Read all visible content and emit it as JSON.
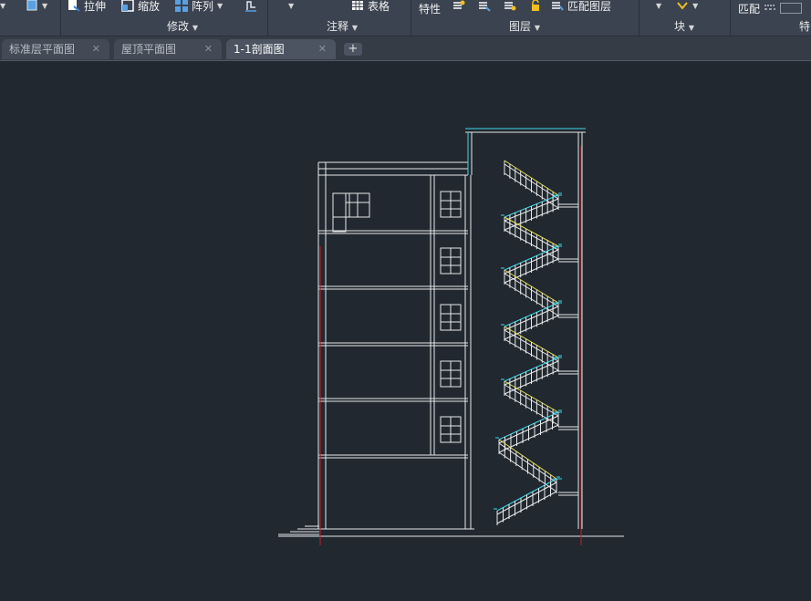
{
  "ribbon": {
    "stretch_label": "拉伸",
    "scale_label": "缩放",
    "array_label": "阵列",
    "table_label": "表格",
    "properties_label": "特性",
    "match_layer_label": "匹配图层",
    "match_label": "匹配",
    "panels": {
      "modify": "修改",
      "annotation": "注释",
      "layers": "图层",
      "block": "块",
      "properties_cut": "特"
    }
  },
  "tabs": [
    {
      "label": "标准层平面图",
      "active": false
    },
    {
      "label": "屋顶平面图",
      "active": false
    },
    {
      "label": "1-1剖面图",
      "active": true
    }
  ],
  "tab_close_glyph": "✕",
  "tab_add_glyph": "+",
  "colors": {
    "canvas": "#212830",
    "line_white": "#e8e8e8",
    "line_cyan": "#3fd8e8",
    "line_yellow": "#e8e04a",
    "line_red": "#c0202a"
  },
  "icons": [
    "dropdown-caret-icon",
    "stretch-icon",
    "scale-icon",
    "array-icon",
    "table-icon",
    "layer-icons",
    "match-icon"
  ]
}
